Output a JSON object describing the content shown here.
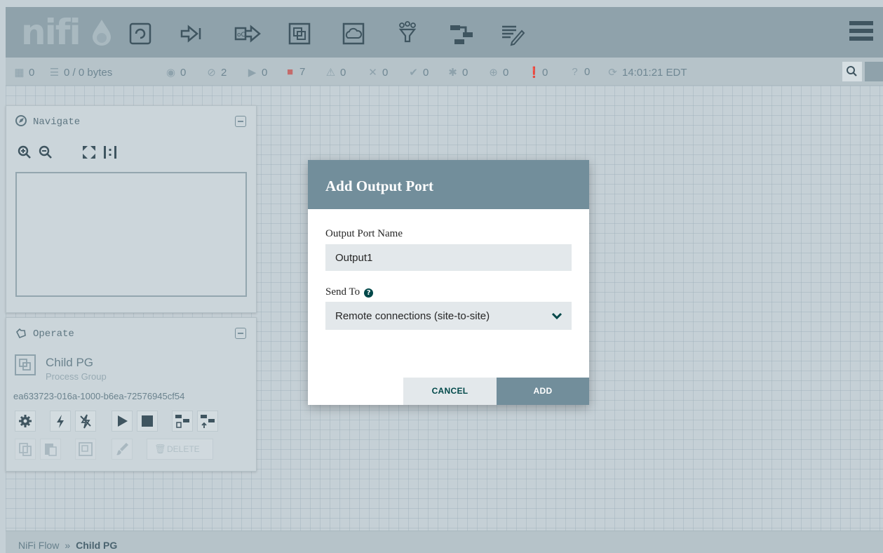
{
  "app": {
    "logo_text": "nifi"
  },
  "toolbar": {
    "tools": [
      "processor-icon",
      "input-port-icon",
      "output-port-icon",
      "process-group-icon",
      "remote-process-group-icon",
      "funnel-icon",
      "template-icon",
      "label-icon"
    ],
    "menu_icon": "hamburger-icon"
  },
  "status": {
    "active_threads": "0",
    "queued": "0 / 0 bytes",
    "transmitting": "0",
    "not_transmitting": "2",
    "running": "0",
    "stopped": "7",
    "invalid": "0",
    "disabled": "0",
    "up_to_date": "0",
    "locally_modified": "0",
    "stale": "0",
    "locally_modified_stale": "0",
    "sync_failure": "0",
    "last_refreshed": "14:01:21 EDT"
  },
  "navigate": {
    "title": "Navigate"
  },
  "operate": {
    "title": "Operate",
    "component_name": "Child PG",
    "component_type": "Process Group",
    "component_id": "ea633723-016a-1000-b6ea-72576945cf54",
    "delete_label": "DELETE"
  },
  "breadcrumb": {
    "root": "NiFi Flow",
    "separator": "»",
    "current": "Child PG"
  },
  "dialog": {
    "title": "Add Output Port",
    "name_label": "Output Port Name",
    "name_value": "Output1",
    "send_to_label": "Send To",
    "send_to_value": "Remote connections (site-to-site)",
    "cancel_label": "CANCEL",
    "add_label": "ADD"
  },
  "colors": {
    "header": "#728e9b",
    "accent": "#004849",
    "toolbar": "#8fa2ab"
  }
}
